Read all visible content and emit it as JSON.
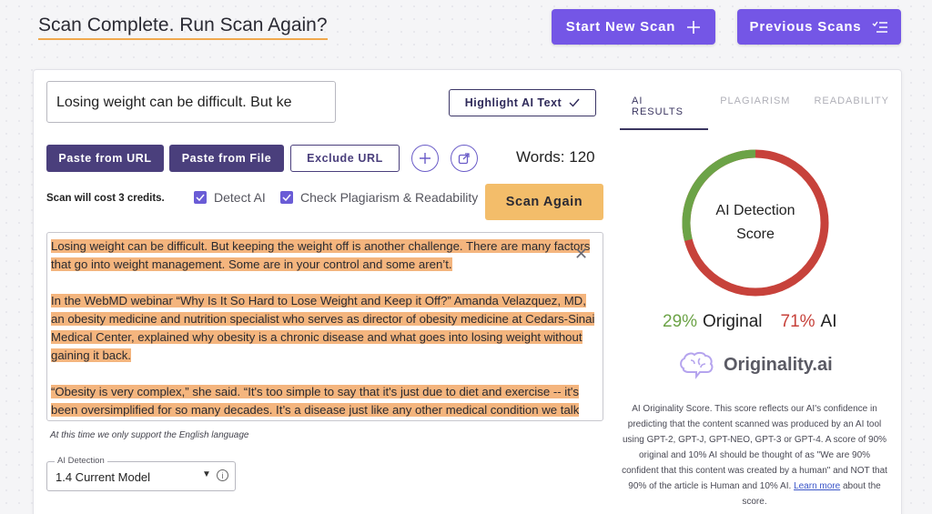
{
  "header": {
    "title": "Scan Complete. Run Scan Again?",
    "start_new_scan": "Start New Scan",
    "previous_scans": "Previous Scans"
  },
  "editor": {
    "title_value": "Losing weight can be difficult. But ke",
    "highlight_label": "Highlight AI Text",
    "paste_url": "Paste from URL",
    "paste_file": "Paste from File",
    "exclude_url": "Exclude URL",
    "words": "Words: 120",
    "cost": "Scan will cost 3 credits.",
    "detect_ai": "Detect AI",
    "check_plagiarism": "Check Plagiarism & Readability",
    "scan_again": "Scan Again",
    "paragraphs": [
      "Losing weight can be difficult. But keeping the weight off is another challenge. There are many factors that go into weight management. Some are in your control and some aren’t.",
      "In the WebMD webinar “Why Is It So Hard to Lose Weight and Keep it Off?” Amanda Velazquez, MD, an obesity medicine and nutrition specialist who serves as director of obesity medicine at Cedars-Sinai Medical Center, explained why obesity is a chronic disease and what goes into losing weight without gaining it back.",
      "“Obesity is very complex,” she said. “It's too simple to say that it's just due to diet and exercise -- it's been oversimplified for so many decades. It’s a disease just like any other medical condition we talk"
    ],
    "language_note": "At this time we only support the English language",
    "model_label": "AI Detection",
    "model_value": "1.4 Current Model"
  },
  "results": {
    "tabs": [
      "AI RESULTS",
      "PLAGIARISM",
      "READABILITY"
    ],
    "donut_line1": "AI Detection",
    "donut_line2": "Score",
    "original_pct": "29%",
    "original_label": "Original",
    "ai_pct": "71%",
    "ai_label": "AI",
    "original_value": 29,
    "ai_value": 71,
    "logo_text": "Originality.ai",
    "description": "AI Originality Score. This score reflects our AI's confidence in predicting that the content scanned was produced by an AI tool using GPT-2, GPT-J, GPT-NEO, GPT-3 or GPT-4. A score of 90% original and 10% AI should be thought of as \"We are 90% confident that this content was created by a human\" and NOT that 90% of the article is Human and 10% AI.",
    "learn_more": "Learn more",
    "description_tail": "about the score.",
    "colors": {
      "original": "#6ca347",
      "ai": "#c7423b",
      "accent": "#7456e6"
    }
  }
}
